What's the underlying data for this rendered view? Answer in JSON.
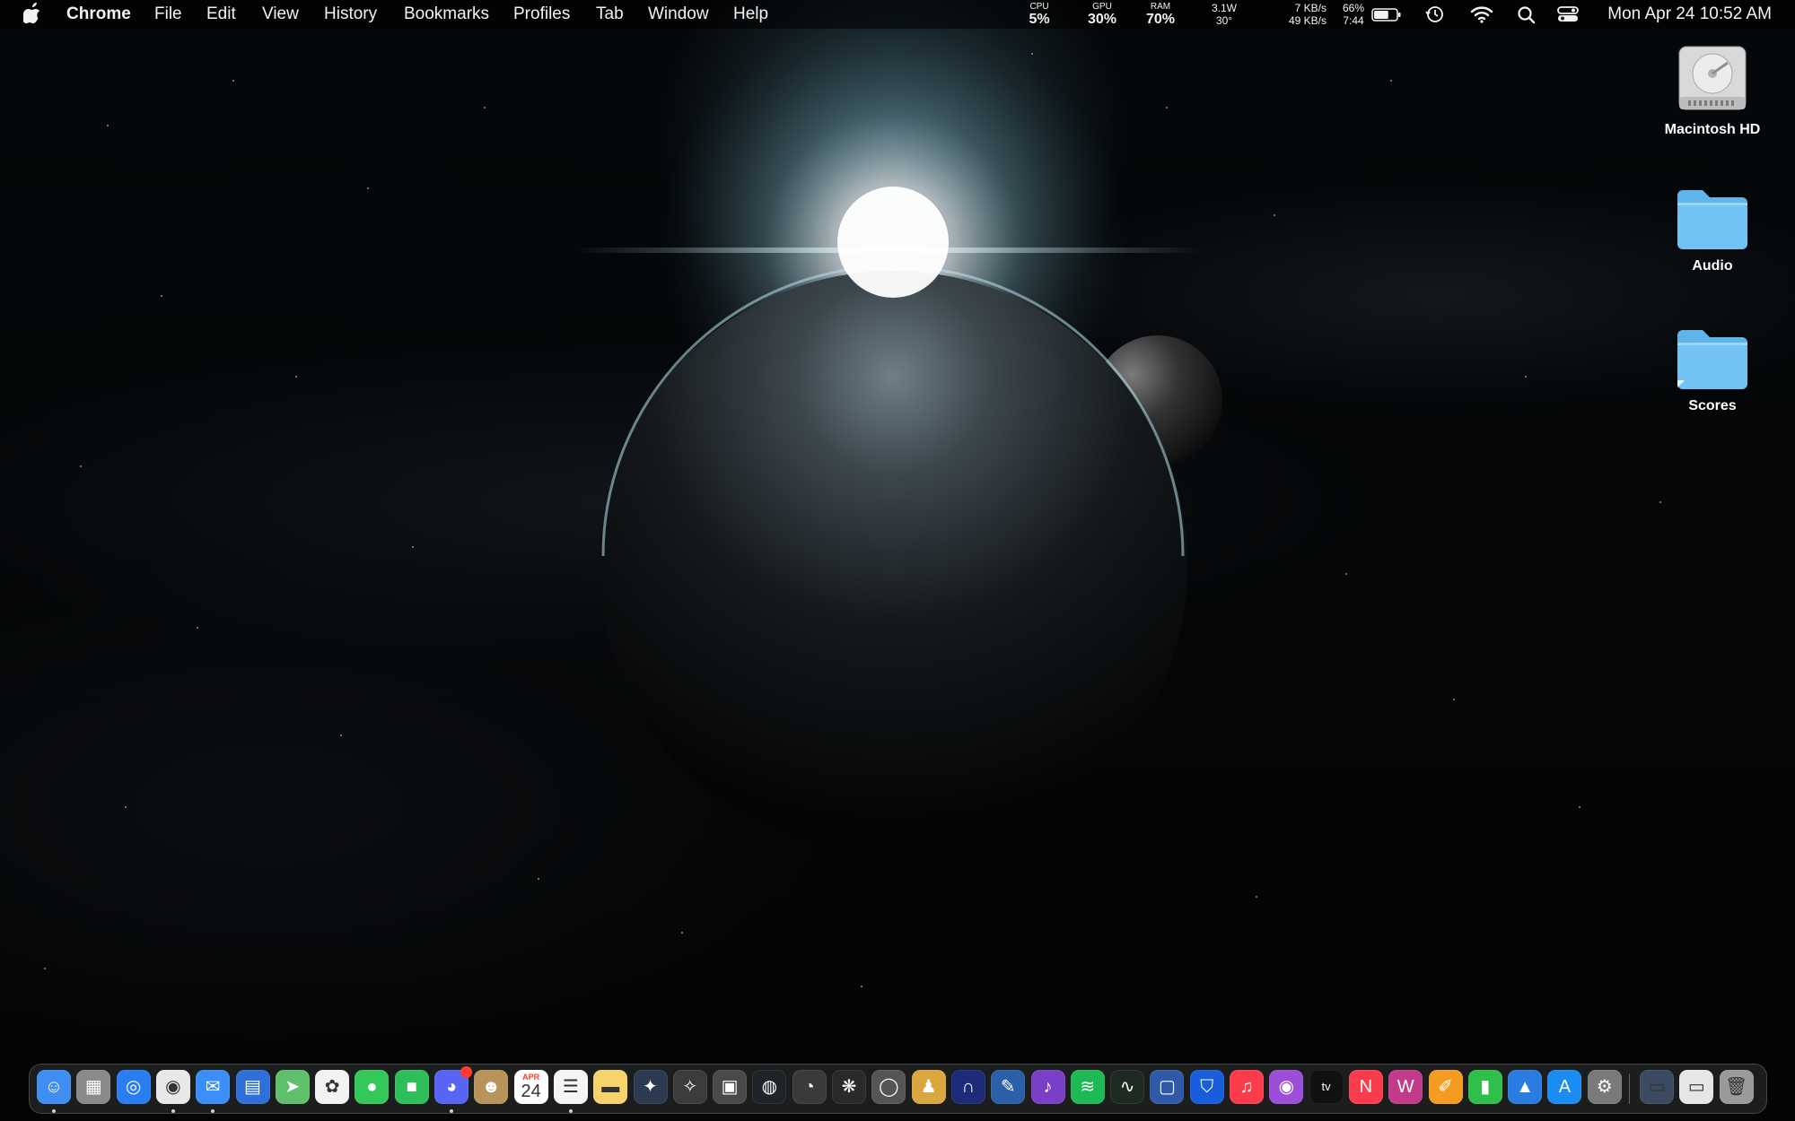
{
  "menubar": {
    "app_name": "Chrome",
    "menus": [
      "File",
      "Edit",
      "View",
      "History",
      "Bookmarks",
      "Profiles",
      "Tab",
      "Window",
      "Help"
    ],
    "stats": {
      "cpu": {
        "label": "CPU",
        "value": "5%"
      },
      "gpu": {
        "label": "GPU",
        "value": "30%"
      },
      "ram": {
        "label": "RAM",
        "value": "70%"
      },
      "power": {
        "line1": "3.1W",
        "line2": "30°"
      },
      "network": {
        "up": "7 KB/s",
        "down": "49 KB/s"
      },
      "battery": {
        "percent": "66%",
        "time": "7:44",
        "level": 0.66
      }
    },
    "clock": "Mon Apr 24  10:52 AM"
  },
  "desktop": {
    "icons": [
      {
        "name": "Macintosh HD",
        "type": "drive"
      },
      {
        "name": "Audio",
        "type": "folder"
      },
      {
        "name": "Scores",
        "type": "folder"
      }
    ]
  },
  "dock": {
    "calendar": {
      "month": "APR",
      "day": "24"
    },
    "apps": [
      {
        "name": "finder",
        "color": "#3d8ef0",
        "glyph": "☺"
      },
      {
        "name": "launchpad",
        "color": "#8a8a8a",
        "glyph": "▦"
      },
      {
        "name": "safari",
        "color": "#2a7df0",
        "glyph": "◎"
      },
      {
        "name": "chrome",
        "color": "#e8e8e8",
        "glyph": "◉"
      },
      {
        "name": "mail",
        "color": "#3b8ef5",
        "glyph": "✉"
      },
      {
        "name": "files",
        "color": "#2f6fd9",
        "glyph": "▤"
      },
      {
        "name": "maps",
        "color": "#5fbf6b",
        "glyph": "➤"
      },
      {
        "name": "photos",
        "color": "#f2f2f2",
        "glyph": "✿"
      },
      {
        "name": "messages",
        "color": "#34c759",
        "glyph": "●"
      },
      {
        "name": "facetime",
        "color": "#2fbf5a",
        "glyph": "■"
      },
      {
        "name": "discord",
        "color": "#5865f2",
        "glyph": "◕"
      },
      {
        "name": "contacts",
        "color": "#b8935a",
        "glyph": "☻"
      },
      {
        "name": "calendar",
        "color": "#ffffff",
        "glyph": ""
      },
      {
        "name": "reminders",
        "color": "#f5f5f5",
        "glyph": "☰"
      },
      {
        "name": "notes",
        "color": "#f6d36b",
        "glyph": "▬"
      },
      {
        "name": "davinci",
        "color": "#2c3a52",
        "glyph": "✦"
      },
      {
        "name": "motion",
        "color": "#3c3c3c",
        "glyph": "✧"
      },
      {
        "name": "compressor",
        "color": "#4a4a4a",
        "glyph": "▣"
      },
      {
        "name": "obs",
        "color": "#202428",
        "glyph": "◍"
      },
      {
        "name": "blender",
        "color": "#3a3a3a",
        "glyph": "◔"
      },
      {
        "name": "aperture",
        "color": "#2a2a2a",
        "glyph": "❋"
      },
      {
        "name": "dvd-player",
        "color": "#555555",
        "glyph": "◯"
      },
      {
        "name": "instruments",
        "color": "#d9a640",
        "glyph": "♟"
      },
      {
        "name": "audio-app",
        "color": "#1d2b7a",
        "glyph": "∩"
      },
      {
        "name": "logic",
        "color": "#2b5fa8",
        "glyph": "✎"
      },
      {
        "name": "music-notation",
        "color": "#7a3fc7",
        "glyph": "♪"
      },
      {
        "name": "spotify",
        "color": "#1db954",
        "glyph": "≋"
      },
      {
        "name": "activity-monitor",
        "color": "#1e2a22",
        "glyph": "∿"
      },
      {
        "name": "screens",
        "color": "#2f5aa8",
        "glyph": "▢"
      },
      {
        "name": "bitwarden",
        "color": "#175ddc",
        "glyph": "⛉"
      },
      {
        "name": "music",
        "color": "#fa3c4c",
        "glyph": "♫"
      },
      {
        "name": "podcasts",
        "color": "#9c4ed8",
        "glyph": "◉"
      },
      {
        "name": "apple-tv",
        "color": "#111111",
        "glyph": "tv"
      },
      {
        "name": "news",
        "color": "#fa3c4c",
        "glyph": "N"
      },
      {
        "name": "soundwave",
        "color": "#c23a8a",
        "glyph": "W"
      },
      {
        "name": "pages",
        "color": "#f39c21",
        "glyph": "✐"
      },
      {
        "name": "numbers",
        "color": "#2fbf4a",
        "glyph": "▮"
      },
      {
        "name": "keynote",
        "color": "#2a7de0",
        "glyph": "▲"
      },
      {
        "name": "app-store",
        "color": "#1a8cf2",
        "glyph": "A"
      },
      {
        "name": "system-settings",
        "color": "#7a7a7a",
        "glyph": "⚙"
      }
    ],
    "running": [
      "finder",
      "chrome",
      "mail",
      "discord",
      "reminders"
    ],
    "right": [
      {
        "name": "screenshot-folder",
        "color": "#3b4a60",
        "glyph": "▭"
      },
      {
        "name": "downloads-stack",
        "color": "#e6e6e6",
        "glyph": "▭"
      },
      {
        "name": "trash",
        "color": "#9a9a9a",
        "glyph": "🗑"
      }
    ]
  }
}
